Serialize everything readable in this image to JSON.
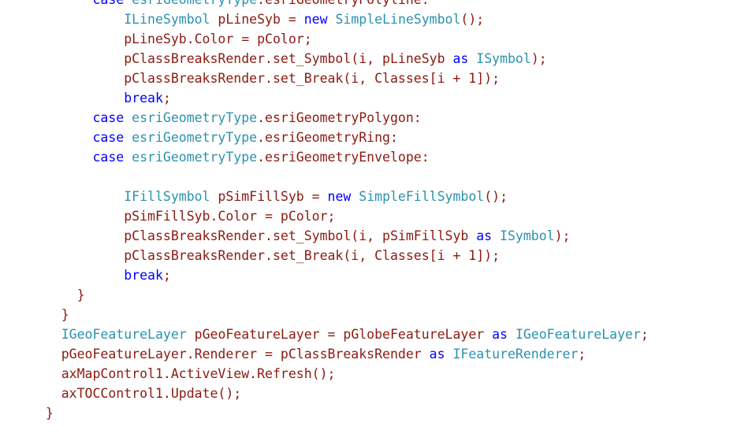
{
  "view": {
    "kind": "source-code-listing",
    "language": "C#",
    "background_color": "#ffffff",
    "font_style": "monospace",
    "first_line_clipped_at_top": true
  },
  "colors": {
    "keyword": "#0000FF",
    "type": "#2B91AF",
    "identifier": "#8B1A10",
    "punctuation": "#8B1A10",
    "background": "#ffffff"
  },
  "code": {
    "lines": [
      {
        "indent": 8,
        "tokens": [
          {
            "text": "case ",
            "kind": "keyword"
          },
          {
            "text": "esriGeometryType",
            "kind": "type"
          },
          {
            "text": ".esriGeometryPolyline:",
            "kind": "identifier"
          }
        ]
      },
      {
        "indent": 12,
        "tokens": [
          {
            "text": "ILineSymbol",
            "kind": "type"
          },
          {
            "text": " pLineSyb = ",
            "kind": "identifier"
          },
          {
            "text": "new ",
            "kind": "keyword"
          },
          {
            "text": "SimpleLineSymbol",
            "kind": "type"
          },
          {
            "text": "();",
            "kind": "identifier"
          }
        ]
      },
      {
        "indent": 12,
        "tokens": [
          {
            "text": "pLineSyb.Color = pColor;",
            "kind": "identifier"
          }
        ]
      },
      {
        "indent": 12,
        "tokens": [
          {
            "text": "pClassBreaksRender.set_Symbol(i, pLineSyb ",
            "kind": "identifier"
          },
          {
            "text": "as ",
            "kind": "keyword"
          },
          {
            "text": "ISymbol",
            "kind": "type"
          },
          {
            "text": ");",
            "kind": "identifier"
          }
        ]
      },
      {
        "indent": 12,
        "tokens": [
          {
            "text": "pClassBreaksRender.set_Break(i, Classes[i + 1]);",
            "kind": "identifier"
          }
        ]
      },
      {
        "indent": 12,
        "tokens": [
          {
            "text": "break",
            "kind": "keyword"
          },
          {
            "text": ";",
            "kind": "identifier"
          }
        ]
      },
      {
        "indent": 8,
        "tokens": [
          {
            "text": "case ",
            "kind": "keyword"
          },
          {
            "text": "esriGeometryType",
            "kind": "type"
          },
          {
            "text": ".esriGeometryPolygon:",
            "kind": "identifier"
          }
        ]
      },
      {
        "indent": 8,
        "tokens": [
          {
            "text": "case ",
            "kind": "keyword"
          },
          {
            "text": "esriGeometryType",
            "kind": "type"
          },
          {
            "text": ".esriGeometryRing:",
            "kind": "identifier"
          }
        ]
      },
      {
        "indent": 8,
        "tokens": [
          {
            "text": "case ",
            "kind": "keyword"
          },
          {
            "text": "esriGeometryType",
            "kind": "type"
          },
          {
            "text": ".esriGeometryEnvelope:",
            "kind": "identifier"
          }
        ]
      },
      {
        "indent": 0,
        "tokens": []
      },
      {
        "indent": 12,
        "tokens": [
          {
            "text": "IFillSymbol",
            "kind": "type"
          },
          {
            "text": " pSimFillSyb = ",
            "kind": "identifier"
          },
          {
            "text": "new ",
            "kind": "keyword"
          },
          {
            "text": "SimpleFillSymbol",
            "kind": "type"
          },
          {
            "text": "();",
            "kind": "identifier"
          }
        ]
      },
      {
        "indent": 12,
        "tokens": [
          {
            "text": "pSimFillSyb.Color = pColor;",
            "kind": "identifier"
          }
        ]
      },
      {
        "indent": 12,
        "tokens": [
          {
            "text": "pClassBreaksRender.set_Symbol(i, pSimFillSyb ",
            "kind": "identifier"
          },
          {
            "text": "as ",
            "kind": "keyword"
          },
          {
            "text": "ISymbol",
            "kind": "type"
          },
          {
            "text": ");",
            "kind": "identifier"
          }
        ]
      },
      {
        "indent": 12,
        "tokens": [
          {
            "text": "pClassBreaksRender.set_Break(i, Classes[i + 1]);",
            "kind": "identifier"
          }
        ]
      },
      {
        "indent": 12,
        "tokens": [
          {
            "text": "break",
            "kind": "keyword"
          },
          {
            "text": ";",
            "kind": "identifier"
          }
        ]
      },
      {
        "indent": 6,
        "tokens": [
          {
            "text": "}",
            "kind": "brace"
          }
        ]
      },
      {
        "indent": 4,
        "tokens": [
          {
            "text": "}",
            "kind": "brace"
          }
        ]
      },
      {
        "indent": 4,
        "tokens": [
          {
            "text": "IGeoFeatureLayer",
            "kind": "type"
          },
          {
            "text": " pGeoFeatureLayer = pGlobeFeatureLayer ",
            "kind": "identifier"
          },
          {
            "text": "as ",
            "kind": "keyword"
          },
          {
            "text": "IGeoFeatureLayer",
            "kind": "type"
          },
          {
            "text": ";",
            "kind": "identifier"
          }
        ]
      },
      {
        "indent": 4,
        "tokens": [
          {
            "text": "pGeoFeatureLayer.Renderer = pClassBreaksRender ",
            "kind": "identifier"
          },
          {
            "text": "as ",
            "kind": "keyword"
          },
          {
            "text": "IFeatureRenderer",
            "kind": "type"
          },
          {
            "text": ";",
            "kind": "identifier"
          }
        ]
      },
      {
        "indent": 4,
        "tokens": [
          {
            "text": "axMapControl1.ActiveView.Refresh();",
            "kind": "identifier"
          }
        ]
      },
      {
        "indent": 4,
        "tokens": [
          {
            "text": "axTOCControl1.Update();",
            "kind": "identifier"
          }
        ]
      },
      {
        "indent": 2,
        "tokens": [
          {
            "text": "}",
            "kind": "brace"
          }
        ]
      }
    ]
  }
}
